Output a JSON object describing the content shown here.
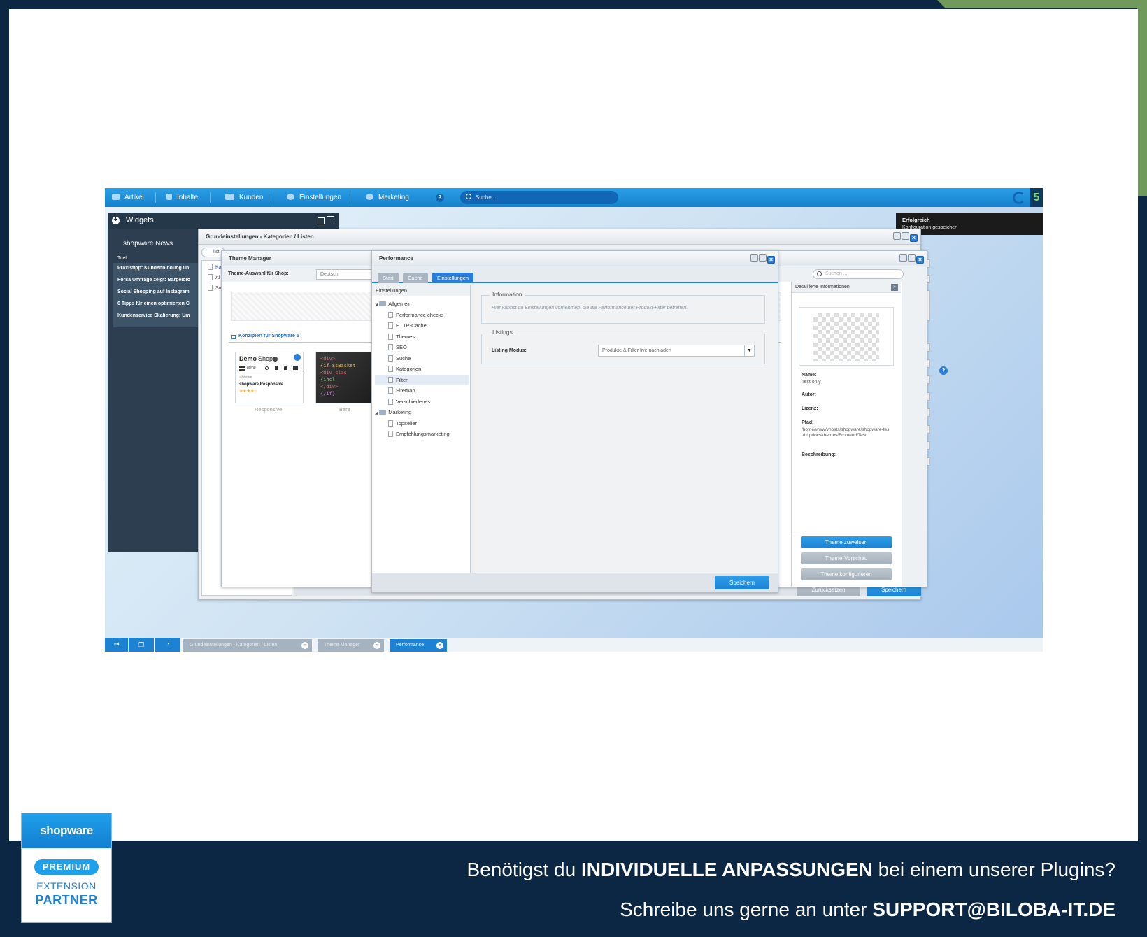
{
  "topbar": {
    "nav": [
      "Artikel",
      "Inhalte",
      "Kunden",
      "Einstellungen",
      "Marketing"
    ],
    "search_placeholder": "Suche..."
  },
  "widgets": {
    "title": "Widgets",
    "news_title": "shopware News",
    "column": "Titel",
    "items": [
      "Praxistipp: Kundenbindung un",
      "Forsa Umfrage zeigt: Bargeldlo",
      "Social Shopping auf Instagram",
      "6 Tipps für einen optimierten C",
      "Kundenservice Skalierung: Um"
    ]
  },
  "notification": {
    "title": "Erfolgreich",
    "text": "Konfiguration gespeichert"
  },
  "grund": {
    "title": "Grundeinstellungen - Kategorien / Listen",
    "search": "list",
    "items": [
      "Ka",
      "Al",
      "Su"
    ],
    "reset": "Zurücksetzen",
    "save": "Speichern"
  },
  "theme": {
    "title": "Theme Manager",
    "shop_label": "Theme-Auswahl für Shop:",
    "shop_value": "Deutsch",
    "search_placeholder": "Suchen ...",
    "section": "Konzipiert für Shopware 5",
    "demo_logo": "Demo",
    "demo_logo2": "Shop",
    "demo_menu": "Menü",
    "demo_back": "< Nächste",
    "demo_product": "shopware Responsive",
    "card1": "Responsive",
    "card2": "Bare",
    "code_lines": [
      "<div>",
      "{if $sBasket",
      "  <div clas",
      "    {incl",
      "  </div>",
      "{/if}"
    ],
    "detail_title": "Detaillierte Informationen",
    "name_label": "Name:",
    "name_value": "Test only",
    "author_label": "Autor:",
    "license_label": "Lizenz:",
    "path_label": "Pfad:",
    "path_value": "/home/www/vhosts/shopware/shopware-test/httpdocs/themes/Frontend/Test",
    "desc_label": "Beschreibung:",
    "btn_assign": "Theme zuweisen",
    "btn_preview": "Theme-Vorschau",
    "btn_config": "Theme konfigurieren"
  },
  "performance": {
    "title": "Performance",
    "tabs": [
      "Start",
      "Cache",
      "Einstellungen"
    ],
    "tree_header": "Einstellungen",
    "group1": "Allgemein",
    "group1_items": [
      "Performance checks",
      "HTTP-Cache",
      "Themes",
      "SEO",
      "Suche",
      "Kategorien",
      "Filter",
      "Sitemap",
      "Verschiedenes"
    ],
    "group2": "Marketing",
    "group2_items": [
      "Topseller",
      "Empfehlungsmarketing"
    ],
    "info_legend": "Information",
    "info_text": "Hier kannst du Einstellungen vornehmen, die die Performance der Produkt-Filter betreffen.",
    "listings_legend": "Listings",
    "listing_label": "Listing Modus:",
    "listing_value": "Produkte & Filter live nachladen",
    "save": "Speichern"
  },
  "taskbar": [
    "Grundeinstellungen - Kategorien / Listen",
    "Theme Manager",
    "Performance"
  ],
  "badge": {
    "brand": "shopware",
    "premium": "PREMIUM",
    "extension": "EXTENSION",
    "partner": "PARTNER"
  },
  "footer": {
    "line1_a": "Benötigst du ",
    "line1_b": "INDIVIDUELLE ANPASSUNGEN",
    "line1_c": " bei einem unserer Plugins?",
    "line2_a": "Schreibe uns gerne an unter ",
    "line2_b": "SUPPORT@BILOBA-IT.DE"
  },
  "colors": {
    "navy": "#0b2744",
    "accent_blue": "#1d82d2",
    "green": "#6f9a5c"
  }
}
